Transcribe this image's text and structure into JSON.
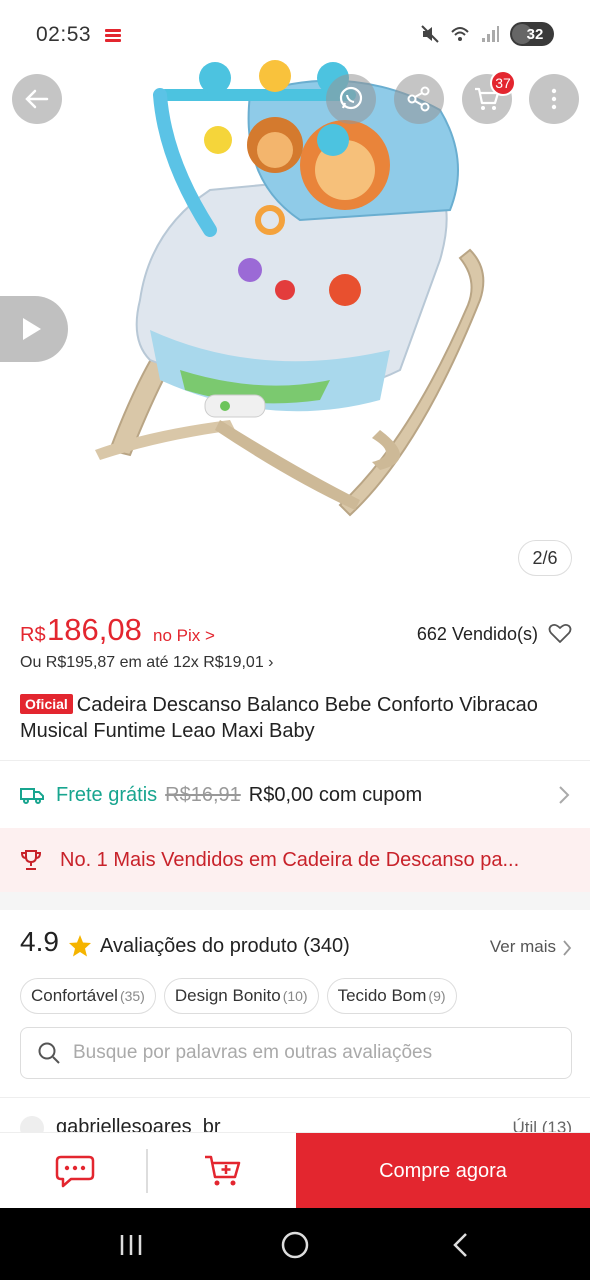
{
  "status_bar": {
    "time": "02:53",
    "battery": "32"
  },
  "product": {
    "image_counter": "2/6",
    "cart_count": "37",
    "price_currency": "R$",
    "price": "186,08",
    "price_method": "no Pix >",
    "sold": "662 Vendido(s)",
    "installments": "Ou R$195,87 em até 12x R$19,01 ›",
    "official_badge": "Oficial",
    "title": "Cadeira Descanso Balanco Bebe Conforto Vibracao Musical Funtime Leao  Maxi Baby"
  },
  "shipping": {
    "free_label": "Frete grátis",
    "old_price": "R$16,91",
    "coupon_text": "R$0,00 com cupom"
  },
  "ranking": {
    "text": "No. 1 Mais Vendidos em Cadeira de Descanso pa..."
  },
  "reviews": {
    "rating": "4.9",
    "title": "Avaliações do produto (340)",
    "see_more": "Ver mais",
    "chips": [
      {
        "label": "Confortável",
        "count": "(35)"
      },
      {
        "label": "Design Bonito",
        "count": "(10)"
      },
      {
        "label": "Tecido Bom",
        "count": "(9)"
      }
    ],
    "search_placeholder": "Busque por palavras em outras avaliações",
    "first_reviewer": "gabriellesoares_br",
    "useful": "Útil (13)"
  },
  "actions": {
    "buy_label": "Compre agora"
  },
  "colors": {
    "brand_red": "#e3262f",
    "free_shipping_green": "#18a58f",
    "ranking_bg": "#fdf0f0"
  },
  "icons": [
    "back-arrow-icon",
    "whatsapp-icon",
    "share-icon",
    "cart-icon",
    "more-icon",
    "play-icon",
    "heart-icon",
    "truck-icon",
    "trophy-icon",
    "star-icon",
    "search-icon",
    "chat-icon",
    "add-cart-icon"
  ]
}
